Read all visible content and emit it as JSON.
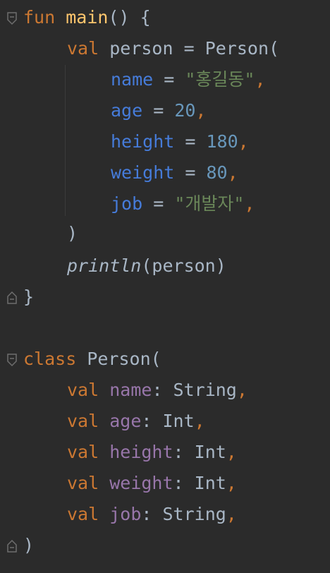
{
  "code": {
    "fun_kw": "fun",
    "main_fn": "main",
    "main_tail": "() {",
    "val_kw": "val",
    "person_var": "person",
    "eq": " = ",
    "person_ctor": "Person(",
    "name_param": "name",
    "name_value": "\"홍길동\"",
    "age_param": "age",
    "age_value": "20",
    "height_param": "height",
    "height_value": "180",
    "weight_param": "weight",
    "weight_value": "80",
    "job_param": "job",
    "job_value": "\"개발자\"",
    "comma": ",",
    "close_paren": ")",
    "println_fn": "println",
    "println_args": "(person)",
    "close_brace": "}",
    "class_kw": "class",
    "class_name": "Person(",
    "prop_name": "name",
    "prop_age": "age",
    "prop_height": "height",
    "prop_weight": "weight",
    "prop_job": "job",
    "type_sep": ": ",
    "type_string": "String",
    "type_int": "Int"
  }
}
